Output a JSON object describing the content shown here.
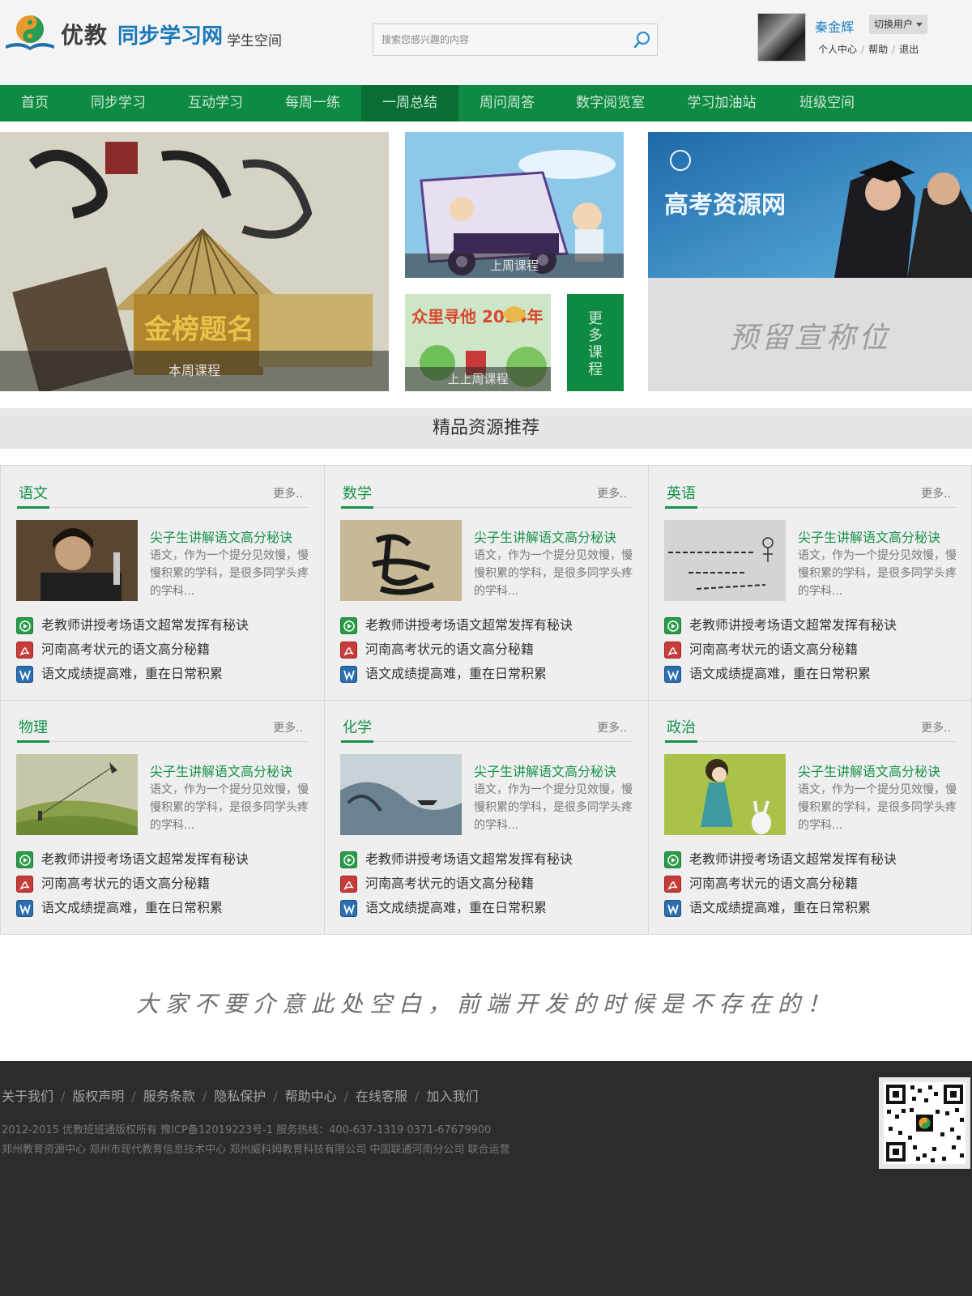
{
  "header": {
    "logo_brand": "优教",
    "logo_sub": "同步学习网",
    "logo_space": "学生空间",
    "search_placeholder": "搜索您感兴趣的内容",
    "username": "秦金辉",
    "switch_user": "切换用户",
    "links": [
      "个人中心",
      "帮助",
      "退出"
    ]
  },
  "nav": {
    "active_index": 4,
    "items": [
      "首页",
      "同步学习",
      "互动学习",
      "每周一练",
      "一周总结",
      "周问周答",
      "数字阅览室",
      "学习加油站",
      "班级空间"
    ]
  },
  "banners": {
    "this_week": "本周课程",
    "last_week": "上周课程",
    "week_before": "上上周课程",
    "more_courses": [
      "更",
      "多",
      "课",
      "程"
    ],
    "gaokao_site": "高考资源网",
    "reserved": "预留宣称位",
    "hero_lettering": "金榜题名",
    "kid_banner_text": "众里寻他 2014年"
  },
  "section_title": "精品资源推荐",
  "cards": [
    {
      "subject": "语文",
      "more": "更多..",
      "feature_title": "尖子生讲解语文高分秘诀",
      "feature_desc": "语文，作为一个提分见效慢，慢慢积累的学科，是很多同学头疼的学科...",
      "links": [
        "老教师讲授考场语文超常发挥有秘诀",
        "河南高考状元的语文高分秘籍",
        "语文成绩提高难，重在日常积累"
      ]
    },
    {
      "subject": "数学",
      "more": "更多..",
      "feature_title": "尖子生讲解语文高分秘诀",
      "feature_desc": "语文，作为一个提分见效慢，慢慢积累的学科，是很多同学头疼的学科...",
      "links": [
        "老教师讲授考场语文超常发挥有秘诀",
        "河南高考状元的语文高分秘籍",
        "语文成绩提高难，重在日常积累"
      ]
    },
    {
      "subject": "英语",
      "more": "更多..",
      "feature_title": "尖子生讲解语文高分秘诀",
      "feature_desc": "语文，作为一个提分见效慢，慢慢积累的学科，是很多同学头疼的学科...",
      "links": [
        "老教师讲授考场语文超常发挥有秘诀",
        "河南高考状元的语文高分秘籍",
        "语文成绩提高难，重在日常积累"
      ]
    },
    {
      "subject": "物理",
      "more": "更多..",
      "feature_title": "尖子生讲解语文高分秘诀",
      "feature_desc": "语文，作为一个提分见效慢，慢慢积累的学科，是很多同学头疼的学科...",
      "links": [
        "老教师讲授考场语文超常发挥有秘诀",
        "河南高考状元的语文高分秘籍",
        "语文成绩提高难，重在日常积累"
      ]
    },
    {
      "subject": "化学",
      "more": "更多..",
      "feature_title": "尖子生讲解语文高分秘诀",
      "feature_desc": "语文，作为一个提分见效慢，慢慢积累的学科，是很多同学头疼的学科...",
      "links": [
        "老教师讲授考场语文超常发挥有秘诀",
        "河南高考状元的语文高分秘籍",
        "语文成绩提高难，重在日常积累"
      ]
    },
    {
      "subject": "政治",
      "more": "更多..",
      "feature_title": "尖子生讲解语文高分秘诀",
      "feature_desc": "语文，作为一个提分见效慢，慢慢积累的学科，是很多同学头疼的学科...",
      "links": [
        "老教师讲授考场语文超常发挥有秘诀",
        "河南高考状元的语文高分秘籍",
        "语文成绩提高难，重在日常积累"
      ]
    }
  ],
  "link_icons": [
    "video-icon",
    "pdf-icon",
    "word-icon"
  ],
  "blank_note": "大家不要介意此处空白，前端开发的时候是不存在的！",
  "footer": {
    "links": [
      "关于我们",
      "版权声明",
      "服务条款",
      "隐私保护",
      "帮助中心",
      "在线客服",
      "加入我们"
    ],
    "copyright": "2012-2015 优教班班通版权所有  豫ICP备12019223号-1     服务热线：400-637-1319   0371-67679900",
    "operators": "郑州教育资源中心    郑州市现代教育信息技术中心   郑州威科姆教育科技有限公司 中国联通河南分公司  联合运营"
  },
  "colors": {
    "nav_green": "#0e8a43",
    "accent_green": "#16924a",
    "link_blue": "#1e7fc2",
    "footer_bg": "#2c2c2c"
  }
}
